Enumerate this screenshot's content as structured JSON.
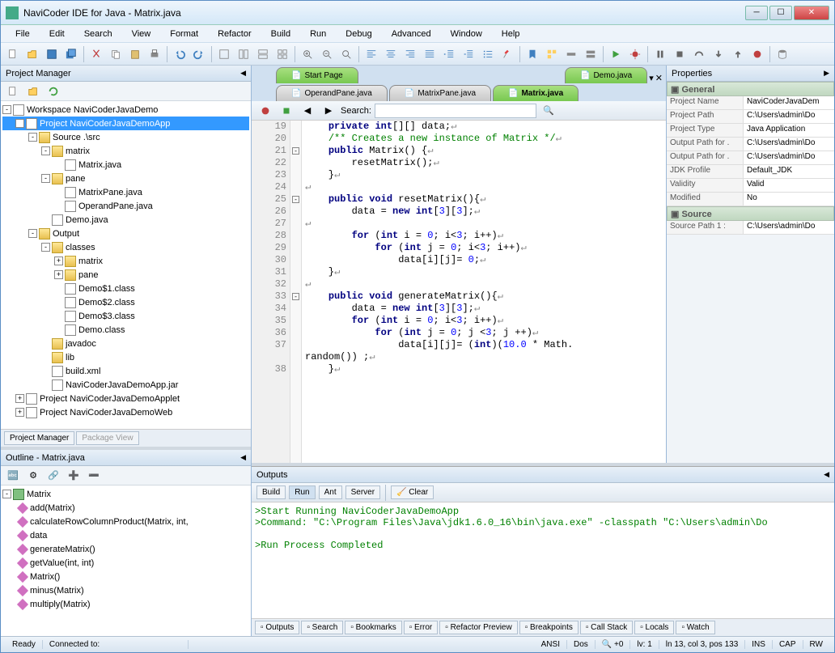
{
  "title": "NaviCoder IDE for Java - Matrix.java",
  "menu": [
    "File",
    "Edit",
    "Search",
    "View",
    "Format",
    "Refactor",
    "Build",
    "Run",
    "Debug",
    "Advanced",
    "Window",
    "Help"
  ],
  "projectManager": {
    "title": "Project Manager",
    "tree": [
      {
        "indent": 0,
        "exp": "-",
        "ico": "ws",
        "label": "Workspace NaviCoderJavaDemo"
      },
      {
        "indent": 1,
        "exp": "-",
        "ico": "prj",
        "label": "Project NaviCoderJavaDemoApp",
        "selected": true
      },
      {
        "indent": 2,
        "exp": "-",
        "ico": "folder",
        "label": "Source .\\src"
      },
      {
        "indent": 3,
        "exp": "-",
        "ico": "folder",
        "label": "matrix"
      },
      {
        "indent": 4,
        "exp": "",
        "ico": "java",
        "label": "Matrix.java"
      },
      {
        "indent": 3,
        "exp": "-",
        "ico": "folder",
        "label": "pane"
      },
      {
        "indent": 4,
        "exp": "",
        "ico": "java",
        "label": "MatrixPane.java"
      },
      {
        "indent": 4,
        "exp": "",
        "ico": "java",
        "label": "OperandPane.java"
      },
      {
        "indent": 3,
        "exp": "",
        "ico": "java",
        "label": "Demo.java"
      },
      {
        "indent": 2,
        "exp": "-",
        "ico": "folder",
        "label": "Output"
      },
      {
        "indent": 3,
        "exp": "-",
        "ico": "folder",
        "label": "classes"
      },
      {
        "indent": 4,
        "exp": "+",
        "ico": "folder",
        "label": "matrix"
      },
      {
        "indent": 4,
        "exp": "+",
        "ico": "folder",
        "label": "pane"
      },
      {
        "indent": 4,
        "exp": "",
        "ico": "file",
        "label": "Demo$1.class"
      },
      {
        "indent": 4,
        "exp": "",
        "ico": "file",
        "label": "Demo$2.class"
      },
      {
        "indent": 4,
        "exp": "",
        "ico": "file",
        "label": "Demo$3.class"
      },
      {
        "indent": 4,
        "exp": "",
        "ico": "file",
        "label": "Demo.class"
      },
      {
        "indent": 3,
        "exp": "",
        "ico": "folder",
        "label": "javadoc"
      },
      {
        "indent": 3,
        "exp": "",
        "ico": "folder",
        "label": "lib"
      },
      {
        "indent": 3,
        "exp": "",
        "ico": "file",
        "label": "build.xml"
      },
      {
        "indent": 3,
        "exp": "",
        "ico": "jar",
        "label": "NaviCoderJavaDemoApp.jar"
      },
      {
        "indent": 1,
        "exp": "+",
        "ico": "prj",
        "label": "Project NaviCoderJavaDemoApplet"
      },
      {
        "indent": 1,
        "exp": "+",
        "ico": "web",
        "label": "Project NaviCoderJavaDemoWeb"
      }
    ],
    "tabs": [
      {
        "label": "Project Manager",
        "active": true
      },
      {
        "label": "Package View",
        "active": false
      }
    ]
  },
  "outline": {
    "title": "Outline - Matrix.java",
    "root": "Matrix",
    "items": [
      "add(Matrix)",
      "calculateRowColumnProduct(Matrix, int,",
      "data",
      "generateMatrix()",
      "getValue(int, int)",
      "Matrix()",
      "minus(Matrix)",
      "multiply(Matrix)"
    ]
  },
  "editor": {
    "tabsTop": [
      {
        "label": "Start Page",
        "style": "green"
      },
      {
        "label": "Demo.java",
        "style": "green"
      }
    ],
    "tabsBottom": [
      {
        "label": "OperandPane.java",
        "style": "gray"
      },
      {
        "label": "MatrixPane.java",
        "style": "gray"
      },
      {
        "label": "Matrix.java",
        "style": "green",
        "active": true
      }
    ],
    "searchLabel": "Search:",
    "lines": [
      {
        "n": 19,
        "html": "    <span class='kw'>private</span> <span class='kw'>int</span>[][] data;<span class='sym'>↵</span>"
      },
      {
        "n": 20,
        "html": "    <span class='cm'>/** Creates a new instance of Matrix */</span><span class='sym'>↵</span>"
      },
      {
        "n": 21,
        "fold": "-",
        "html": "    <span class='kw'>public</span> Matrix() {<span class='sym'>↵</span>"
      },
      {
        "n": 22,
        "html": "        resetMatrix();<span class='sym'>↵</span>"
      },
      {
        "n": 23,
        "html": "    }<span class='sym'>↵</span>"
      },
      {
        "n": 24,
        "html": "<span class='sym'>↵</span>"
      },
      {
        "n": 25,
        "fold": "-",
        "html": "    <span class='kw'>public</span> <span class='kw'>void</span> resetMatrix(){<span class='sym'>↵</span>"
      },
      {
        "n": 26,
        "html": "        data = <span class='kw'>new</span> <span class='kw'>int</span>[<span class='num'>3</span>][<span class='num'>3</span>];<span class='sym'>↵</span>"
      },
      {
        "n": 27,
        "html": "<span class='sym'>↵</span>"
      },
      {
        "n": 28,
        "html": "        <span class='kw'>for</span> (<span class='kw'>int</span> i = <span class='num'>0</span>; i&lt;<span class='num'>3</span>; i++)<span class='sym'>↵</span>"
      },
      {
        "n": 29,
        "html": "            <span class='kw'>for</span> (<span class='kw'>int</span> j = <span class='num'>0</span>; i&lt;<span class='num'>3</span>; i++)<span class='sym'>↵</span>"
      },
      {
        "n": 30,
        "html": "                data[i][j]= <span class='num'>0</span>;<span class='sym'>↵</span>"
      },
      {
        "n": 31,
        "html": "    }<span class='sym'>↵</span>"
      },
      {
        "n": 32,
        "html": "<span class='sym'>↵</span>"
      },
      {
        "n": 33,
        "fold": "-",
        "html": "    <span class='kw'>public</span> <span class='kw'>void</span> generateMatrix(){<span class='sym'>↵</span>"
      },
      {
        "n": 34,
        "html": "        data = <span class='kw'>new</span> <span class='kw'>int</span>[<span class='num'>3</span>][<span class='num'>3</span>];<span class='sym'>↵</span>"
      },
      {
        "n": 35,
        "html": "        <span class='kw'>for</span> (<span class='kw'>int</span> i = <span class='num'>0</span>; i&lt;<span class='num'>3</span>; i++)<span class='sym'>↵</span>"
      },
      {
        "n": 36,
        "html": "            <span class='kw'>for</span> (<span class='kw'>int</span> j = <span class='num'>0</span>; j &lt;<span class='num'>3</span>; j ++)<span class='sym'>↵</span>"
      },
      {
        "n": 37,
        "html": "                data[i][j]= (<span class='kw'>int</span>)(<span class='num'>10.0</span> * Math."
      },
      {
        "n": "",
        "html": "random()) ;<span class='sym'>↵</span>"
      },
      {
        "n": 38,
        "html": "    }<span class='sym'>↵</span>"
      }
    ]
  },
  "properties": {
    "title": "Properties",
    "sections": [
      {
        "name": "General",
        "rows": [
          {
            "k": "Project Name",
            "v": "NaviCoderJavaDem"
          },
          {
            "k": "Project Path",
            "v": "C:\\Users\\admin\\Do"
          },
          {
            "k": "Project Type",
            "v": "Java Application"
          },
          {
            "k": "Output Path for .",
            "v": "C:\\Users\\admin\\Do"
          },
          {
            "k": "Output Path for .",
            "v": "C:\\Users\\admin\\Do"
          },
          {
            "k": "JDK Profile",
            "v": "Default_JDK"
          },
          {
            "k": "Validity",
            "v": "Valid"
          },
          {
            "k": "Modified",
            "v": "No"
          }
        ]
      },
      {
        "name": "Source",
        "rows": [
          {
            "k": "Source Path 1 :",
            "v": "C:\\Users\\admin\\Do"
          }
        ]
      }
    ]
  },
  "outputs": {
    "title": "Outputs",
    "tabs": [
      "Build",
      "Run",
      "Ant",
      "Server"
    ],
    "activeTab": "Run",
    "clear": "Clear",
    "lines": [
      ">Start Running NaviCoderJavaDemoApp",
      ">Command: \"C:\\Program Files\\Java\\jdk1.6.0_16\\bin\\java.exe\" -classpath \"C:\\Users\\admin\\Do",
      "",
      ">Run Process Completed"
    ],
    "bottomTabs": [
      "Outputs",
      "Search",
      "Bookmarks",
      "Error",
      "Refactor Preview",
      "Breakpoints",
      "Call Stack",
      "Locals",
      "Watch"
    ]
  },
  "status": {
    "ready": "Ready",
    "connected": "Connected to:",
    "ansi": "ANSI",
    "dos": "Dos",
    "zoom": "+0",
    "lv": "lv: 1",
    "pos": "ln 13, col 3, pos 133",
    "ins": "INS",
    "cap": "CAP",
    "rw": "RW"
  }
}
